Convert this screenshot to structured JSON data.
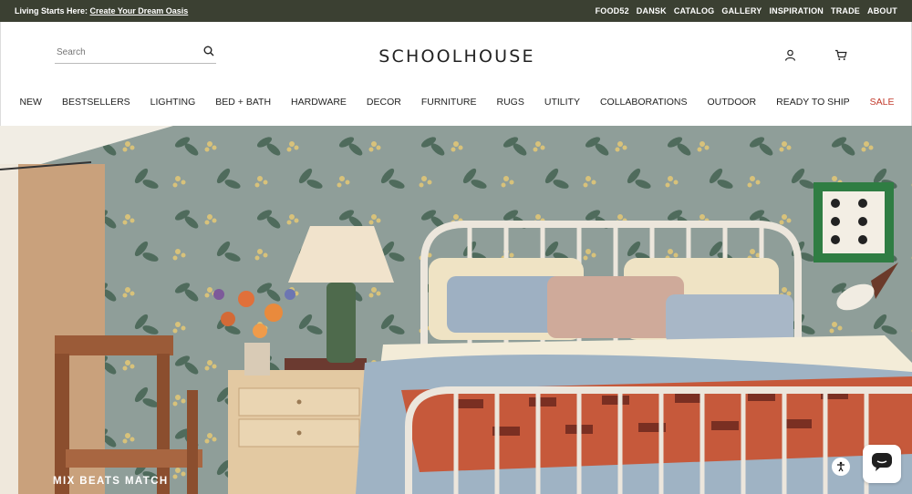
{
  "topbar": {
    "promo_prefix": "Living Starts Here:",
    "promo_link": "Create Your Dream Oasis",
    "links": [
      "FOOD52",
      "DANSK",
      "CATALOG",
      "GALLERY",
      "INSPIRATION",
      "TRADE",
      "ABOUT"
    ]
  },
  "header": {
    "search_placeholder": "Search",
    "logo": "SCHOOLHOUSE"
  },
  "nav": {
    "items": [
      "NEW",
      "BESTSELLERS",
      "LIGHTING",
      "BED + BATH",
      "HARDWARE",
      "DECOR",
      "FURNITURE",
      "RUGS",
      "UTILITY",
      "COLLABORATIONS",
      "OUTDOOR",
      "READY TO SHIP",
      "SALE"
    ]
  },
  "hero": {
    "caption": "MIX BEATS MATCH"
  },
  "colors": {
    "topbar_bg": "#3b4032",
    "sale": "#c23b2c"
  }
}
